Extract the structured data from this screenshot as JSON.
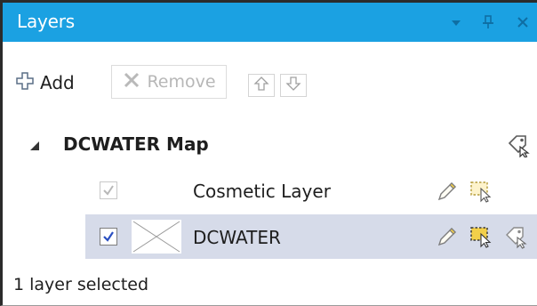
{
  "window": {
    "title": "Layers",
    "controls": [
      "dropdown-icon",
      "pin-icon",
      "close-icon"
    ]
  },
  "toolbar": {
    "add_label": "Add",
    "remove_label": "Remove",
    "remove_enabled": false,
    "move_up_icon": "arrow-up-icon",
    "move_down_icon": "arrow-down-icon"
  },
  "tree": {
    "map_name": "DCWATER Map",
    "map_expanded": true,
    "layers": [
      {
        "name": "Cosmetic Layer",
        "checked": true,
        "checkbox_enabled": false,
        "selected": false,
        "icons": [
          "edit-pencil-icon",
          "selectable-icon"
        ]
      },
      {
        "name": "DCWATER",
        "checked": true,
        "checkbox_enabled": true,
        "selected": true,
        "icons": [
          "edit-pencil-icon",
          "selectable-icon",
          "labels-icon"
        ]
      }
    ]
  },
  "status": {
    "text": "1 layer selected"
  },
  "colors": {
    "title_bar": "#1ba1e2",
    "selected_row": "#d6dbe9",
    "accent_blue": "#2a4fc1",
    "icon_yellow": "#f2cf4a"
  }
}
